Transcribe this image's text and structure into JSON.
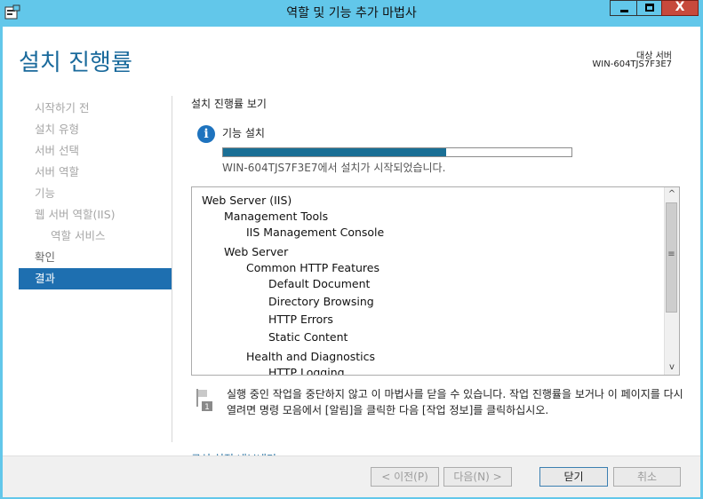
{
  "window": {
    "title": "역할 및 기능 추가 마법사",
    "close_glyph": "X"
  },
  "header": {
    "title": "설치 진행률",
    "target_label": "대상 서버",
    "target_name": "WIN-604TJS7F3E7"
  },
  "nav": {
    "items": [
      {
        "label": "시작하기 전"
      },
      {
        "label": "설치 유형"
      },
      {
        "label": "서버 선택"
      },
      {
        "label": "서버 역할"
      },
      {
        "label": "기능"
      },
      {
        "label": "웹 서버 역할(IIS)"
      },
      {
        "label": "역할 서비스"
      },
      {
        "label": "확인"
      },
      {
        "label": "결과"
      }
    ]
  },
  "content": {
    "section_title": "설치 진행률 보기",
    "info_glyph": "i",
    "feature_label": "기능 설치",
    "progress_fraction": 0.64,
    "status": "WIN-604TJS7F3E7에서 설치가 시작되었습니다.",
    "list": [
      "Web Server (IIS)",
      "Management Tools",
      "IIS Management Console",
      "Web Server",
      "Common HTTP Features",
      "Default Document",
      "Directory Browsing",
      "HTTP Errors",
      "Static Content",
      "Health and Diagnostics",
      "HTTP Logging"
    ],
    "scroll": {
      "up": "^",
      "down": "v",
      "grip": "≡"
    },
    "note": "실행 중인 작업을 중단하지 않고 이 마법사를 닫을 수 있습니다. 작업 진행률을 보거나 이 페이지를 다시 열려면 명령 모음에서 [알림]을 클릭한 다음 [작업 정보]를 클릭하십시오.",
    "note_badge": "1",
    "export_link": "구성 설정 내보내기"
  },
  "footer": {
    "prev": "< 이전(P)",
    "next": "다음(N) >",
    "close": "닫기",
    "cancel": "취소"
  },
  "colors": {
    "titlebar": "#62c7ea",
    "accent": "#1e6fb0",
    "progress": "#1a6f95"
  }
}
